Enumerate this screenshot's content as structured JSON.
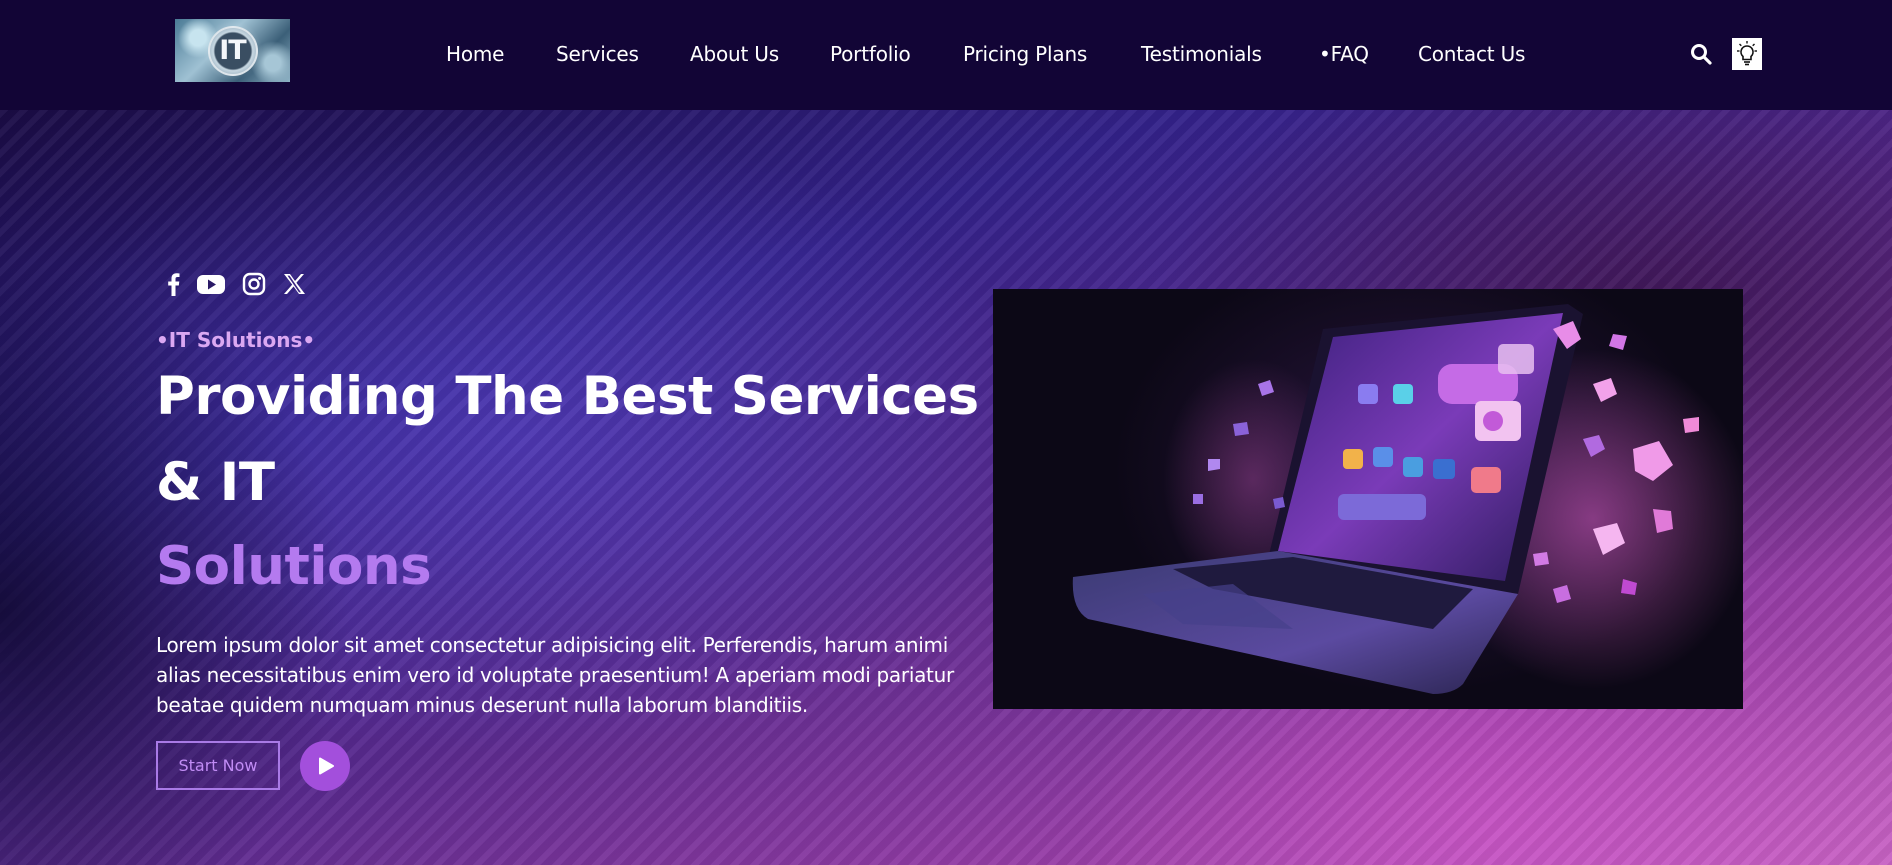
{
  "header": {
    "logo_text": "IT",
    "nav": [
      {
        "label": "Home"
      },
      {
        "label": "Services"
      },
      {
        "label": "About Us"
      },
      {
        "label": "Portfolio"
      },
      {
        "label": "Pricing Plans"
      },
      {
        "label": "Testimonials"
      },
      {
        "label": "•FAQ"
      },
      {
        "label": "Contact Us"
      }
    ],
    "icons": {
      "search": "search-icon",
      "theme": "lightbulb-icon"
    }
  },
  "hero": {
    "social_icons": [
      "facebook-icon",
      "youtube-icon",
      "instagram-icon",
      "x-icon"
    ],
    "tagline": "•IT Solutions•",
    "headline_line1": "Providing The Best Services",
    "headline_line2": "& IT",
    "headline_line3": "Solutions",
    "description": "Lorem ipsum dolor sit amet consectetur adipisicing elit. Perferendis, harum animi alias necessitatibus enim vero id voluptate praesentium! A aperiam modi pariatur beatae quidem numquam minus deserunt nulla laborum blanditiis.",
    "start_button": "Start Now",
    "play_icon": "play-icon",
    "image": "laptop-illustration"
  },
  "colors": {
    "header_bg": "#120536",
    "accent_purple": "#b47aef",
    "tagline_pink": "#dba8f2",
    "play_button": "#a34fdc"
  }
}
